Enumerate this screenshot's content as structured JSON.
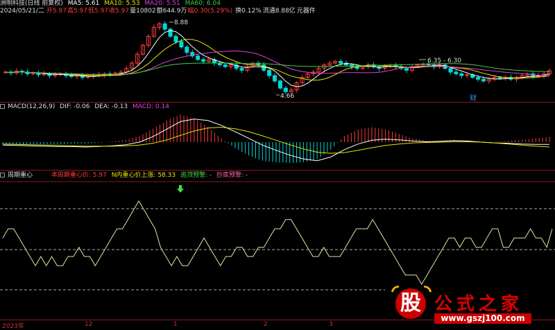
{
  "colors": {
    "background": "#000000",
    "separator": "#8b1a1a",
    "up": "#ff3b3b",
    "down": "#00d8d8",
    "ma5": "#ffffff",
    "ma10": "#e8e800",
    "ma20": "#e040e0",
    "ma60": "#40d040",
    "pink": "#ff66aa",
    "yellow": "#e8e800",
    "green": "#44dd44",
    "red": "#ff3b3b"
  },
  "price_panel": {
    "title": "洲明科技(日线 前复权)",
    "ma5": "MA5: 5.61",
    "ma10": "MA10: 5.53",
    "ma20": "MA20: 5.51",
    "ma60": "MA60: 6.04",
    "info_date": "2024/05/21/二",
    "info_open": "开5.97",
    "info_high": "高5.97",
    "info_low": "低5.97",
    "info_close": "收5.97",
    "info_volume": "量10802",
    "info_amount": "额644.9万",
    "info_change": "幅0.30(5.29%)",
    "info_turnover": "换0.12%",
    "info_float": "流通8.88亿",
    "info_sector": "元器件",
    "label_high": "8.88",
    "label_low": "4.66",
    "label_range": "6.35 - 6.30",
    "label_cai": "财"
  },
  "macd_panel": {
    "title": "MACD(12,26,9)",
    "dif": "DIF: -0.06",
    "dea": "DEA: -0.13",
    "macd": "MACD: 0.14"
  },
  "cycle_panel": {
    "title": "周期重心",
    "center_price": "本周期重心价: 5.97",
    "n_rise": "N内重心价上涨: 58.33",
    "top_warn": "逃顶预警: -",
    "bottom_warn": "抄底预警: -"
  },
  "time_axis": {
    "labels": [
      "2023年",
      "12",
      "1",
      "2",
      "3"
    ]
  },
  "watermark": {
    "logo_char": "股",
    "title": "公式之家",
    "url": "www.gszj100.com"
  },
  "chart_data": [
    {
      "type": "candlestick",
      "title": "洲明科技(日线 前复权)",
      "annotations": [
        "8.88",
        "4.66",
        "6.35 - 6.30",
        "财"
      ],
      "close_approx": [
        5.9,
        5.85,
        5.95,
        5.9,
        5.8,
        5.85,
        5.75,
        5.8,
        5.7,
        5.75,
        5.8,
        5.7,
        5.65,
        5.7,
        5.6,
        5.65,
        5.7,
        5.75,
        5.8,
        5.75,
        5.85,
        5.9,
        6.1,
        6.4,
        6.9,
        7.4,
        7.9,
        8.4,
        8.6,
        8.3,
        7.9,
        7.6,
        7.3,
        7.0,
        6.8,
        6.6,
        6.5,
        6.6,
        6.4,
        6.3,
        6.2,
        6.3,
        6.1,
        6.0,
        6.2,
        6.4,
        6.3,
        6.0,
        5.7,
        5.4,
        5.0,
        4.8,
        4.9,
        5.3,
        5.6,
        5.8,
        5.9,
        6.1,
        6.3,
        6.4,
        6.5,
        6.4,
        6.3,
        6.2,
        6.1,
        6.2,
        6.3,
        6.2,
        6.1,
        6.2,
        6.3,
        6.2,
        6.1,
        6.0,
        6.2,
        6.3,
        6.35,
        6.3,
        6.2,
        6.3,
        6.1,
        5.9,
        5.8,
        5.7,
        5.75,
        5.6,
        5.5,
        5.4,
        5.5,
        5.6,
        5.55,
        5.6,
        5.5,
        5.6,
        5.7,
        5.8,
        5.65,
        5.7,
        5.8,
        5.97
      ]
    },
    {
      "type": "macd",
      "series": [
        {
          "name": "DIF",
          "values": [
            -0.08,
            -0.09,
            -0.1,
            -0.11,
            -0.12,
            -0.12,
            -0.13,
            -0.12,
            -0.1,
            -0.07,
            0.0,
            0.15,
            0.35,
            0.55,
            0.62,
            0.58,
            0.45,
            0.28,
            0.1,
            -0.08,
            -0.22,
            -0.35,
            -0.45,
            -0.5,
            -0.4,
            -0.2,
            -0.05,
            0.05,
            0.08,
            0.06,
            0.03,
            0.01,
            0.02,
            0.04,
            0.03,
            0.0,
            -0.02,
            -0.03,
            -0.05,
            -0.06,
            -0.06
          ]
        },
        {
          "name": "DEA",
          "values": [
            -0.05,
            -0.06,
            -0.07,
            -0.08,
            -0.09,
            -0.1,
            -0.11,
            -0.11,
            -0.11,
            -0.1,
            -0.08,
            -0.03,
            0.06,
            0.18,
            0.3,
            0.38,
            0.4,
            0.36,
            0.28,
            0.17,
            0.05,
            -0.07,
            -0.18,
            -0.27,
            -0.3,
            -0.28,
            -0.22,
            -0.15,
            -0.09,
            -0.05,
            -0.02,
            -0.01,
            0.0,
            0.01,
            0.01,
            0.0,
            -0.02,
            -0.05,
            -0.08,
            -0.11,
            -0.13
          ]
        },
        {
          "name": "MACD",
          "values": [
            -0.06,
            -0.06,
            -0.06,
            -0.06,
            -0.06,
            -0.04,
            -0.04,
            -0.02,
            0.02,
            0.06,
            0.16,
            0.36,
            0.58,
            0.74,
            0.64,
            0.4,
            0.1,
            -0.16,
            -0.36,
            -0.5,
            -0.54,
            -0.56,
            -0.54,
            -0.46,
            -0.2,
            0.16,
            0.34,
            0.4,
            0.34,
            0.22,
            0.1,
            0.04,
            0.04,
            0.06,
            0.04,
            0.0,
            0.0,
            0.04,
            0.06,
            0.1,
            0.14
          ]
        }
      ]
    },
    {
      "type": "line",
      "title": "周期重心",
      "values": [
        5,
        6,
        6,
        5,
        4,
        3,
        2,
        3,
        2,
        3,
        2,
        2,
        3,
        3,
        4,
        3,
        3,
        2,
        3,
        4,
        5,
        6,
        6,
        7,
        8,
        9,
        8,
        7,
        6,
        4,
        3,
        2,
        3,
        2,
        2,
        3,
        4,
        5,
        4,
        3,
        2,
        3,
        3,
        4,
        4,
        3,
        3,
        4,
        4,
        5,
        6,
        6,
        7,
        7,
        6,
        5,
        4,
        3,
        3,
        4,
        3,
        3,
        3,
        4,
        5,
        6,
        6,
        6,
        7,
        6,
        5,
        4,
        3,
        2,
        1,
        1,
        1,
        0,
        1,
        2,
        3,
        4,
        5,
        5,
        4,
        5,
        5,
        4,
        4,
        5,
        6,
        6,
        4,
        4,
        5,
        5,
        5,
        6,
        5,
        5,
        4,
        6
      ]
    }
  ]
}
